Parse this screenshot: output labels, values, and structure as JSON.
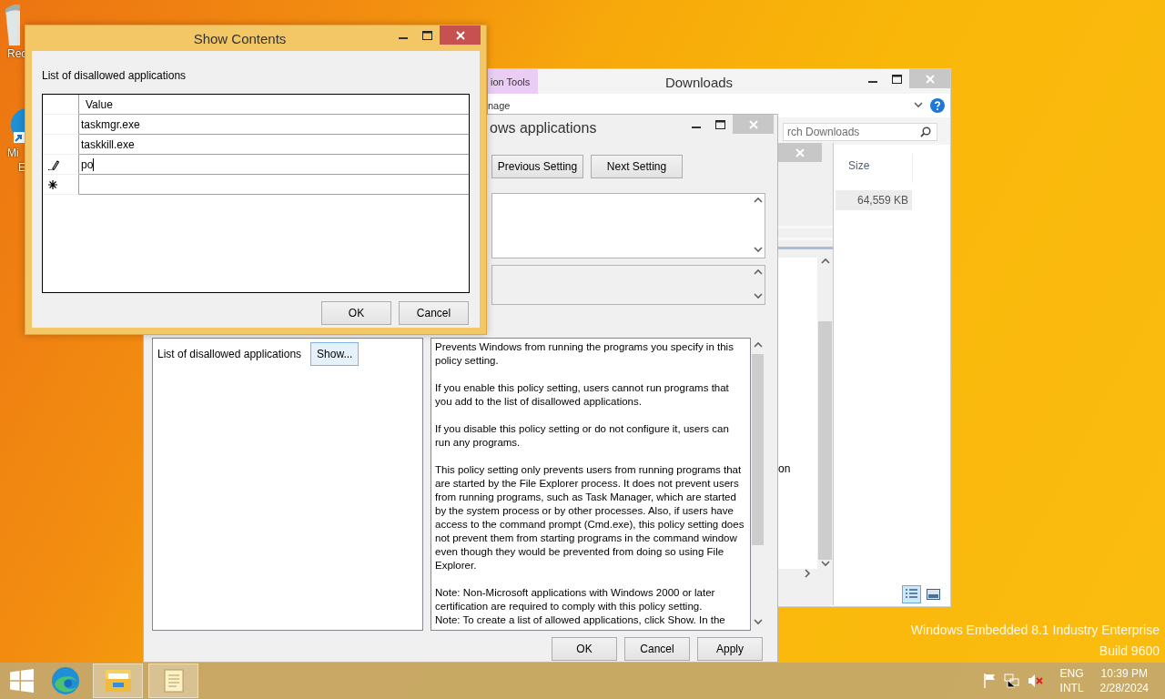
{
  "desktop": {
    "icons": [
      {
        "kind": "recycle_bin",
        "label_lines": [
          "Rec"
        ]
      },
      {
        "kind": "browser_shortcut",
        "label_lines": [
          "Mi",
          "E"
        ]
      }
    ],
    "edition_lines": [
      "Windows Embedded 8.1 Industry Enterprise",
      "Build 9600"
    ]
  },
  "explorer_window": {
    "ribbon_tab": "ion Tools",
    "title": "Downloads",
    "ribbon_item": "nage",
    "search": {
      "placeholder": "rch Downloads"
    },
    "column": "Size",
    "rows": [
      {
        "size": "64,559 KB",
        "selected": true
      }
    ],
    "views": [
      {
        "kind": "details",
        "selected": true
      },
      {
        "kind": "tiles",
        "selected": false
      }
    ]
  },
  "side_window": {
    "text": "on"
  },
  "policy_window": {
    "title": "ows applications",
    "nav_buttons": [
      "Previous Setting",
      "Next Setting"
    ],
    "option_label": "List of disallowed applications",
    "show_button": "Show...",
    "help_blocks": [
      [
        "Prevents Windows from running the programs you specify in this policy setting."
      ],
      [
        "If you enable this policy setting, users cannot run programs that you add to the list of disallowed applications."
      ],
      [
        "If you disable this policy setting or do not configure it, users can run any programs."
      ],
      [
        "This policy setting only prevents users from running programs that are started by the File Explorer process. It does not prevent users from running programs, such as Task Manager, which are started by the system process or by other processes.  Also, if users have access to the command prompt (Cmd.exe), this policy setting does not prevent them from starting programs in the command window even though they would be prevented from doing so using File Explorer."
      ],
      [
        "Note: Non-Microsoft applications with Windows 2000 or later certification are required to comply with this policy setting.",
        "Note: To create a list of allowed applications, click Show.  In the"
      ]
    ],
    "buttons": [
      "OK",
      "Cancel",
      "Apply"
    ]
  },
  "dialog": {
    "title": "Show Contents",
    "label": "List of disallowed applications",
    "column": "Value",
    "rows": [
      {
        "kind": "row",
        "value": "taskmgr.exe"
      },
      {
        "kind": "row",
        "value": "taskkill.exe"
      },
      {
        "kind": "editing",
        "value": "po"
      },
      {
        "kind": "new"
      }
    ],
    "buttons": [
      "OK",
      "Cancel"
    ]
  },
  "taskbar": {
    "apps": [
      {
        "kind": "start",
        "open": false
      },
      {
        "kind": "browser",
        "open": false
      },
      {
        "kind": "explorer",
        "open": true
      },
      {
        "kind": "notepad",
        "open": true
      }
    ],
    "tray": {
      "muted": true,
      "language": "ENG",
      "layout": "INTL",
      "time": "10:39 PM",
      "date": "2/28/2024"
    }
  }
}
